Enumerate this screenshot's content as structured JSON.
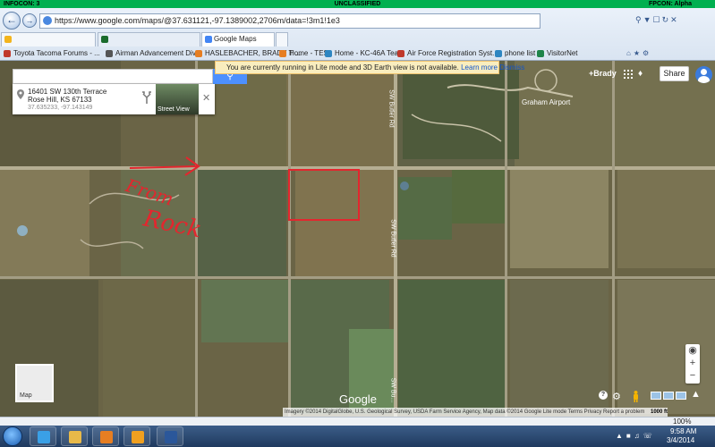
{
  "classification": {
    "left": "INFOCON: 3",
    "center": "UNCLASSIFIED",
    "right": "FPCON: Alpha"
  },
  "browser": {
    "url": "https://www.google.com/maps/@37.631121,-97.1389002,2706m/data=!3m1!1e3",
    "tabs": [
      {
        "label": ""
      },
      {
        "label": ""
      },
      {
        "label": "Google Maps"
      }
    ],
    "bookmarks": [
      "Toyota Tacoma Forums - ...",
      "Airman Advancement Div...",
      "HASLEBACHER, BRADY T ...",
      "Home - TES",
      "Home - KC-46A Team",
      "Air Force Registration Syst...",
      "phone list",
      "VisitorNet"
    ],
    "zoom_level": "100%"
  },
  "maps": {
    "search_value": "",
    "lite_banner": {
      "text": "You are currently running in Lite mode and 3D Earth view is not available.",
      "learn_more": "Learn more",
      "dismiss": "Dismiss"
    },
    "user_name": "+Brady",
    "share_label": "Share",
    "place": {
      "line1": "16401 SW 130th Terrace",
      "line2": "Rose Hill, KS 67133",
      "coords": "37.635233, -97.143149",
      "street_view_label": "Street View"
    },
    "map_labels": {
      "airport": "Graham Airport",
      "road_1": "SW Butler Rd",
      "road_2": "SW Butler Rd",
      "road_3": "SW Bu..."
    },
    "annotation": {
      "text_1": "From",
      "text_2": "Rock"
    },
    "thumb_label": "Map",
    "google_logo": "Google",
    "attribution": "Imagery ©2014 DigitalGlobe, U.S. Geological Survey, USDA Farm Service Agency, Map data ©2014 Google    Lite mode    Terms    Privacy    Report a problem",
    "scale": "1000 ft"
  },
  "taskbar": {
    "time": "9:58 AM",
    "date": "3/4/2014"
  },
  "colors": {
    "classbar": "#00b050",
    "annotation": "#e3262e",
    "accent": "#4d90fe"
  }
}
